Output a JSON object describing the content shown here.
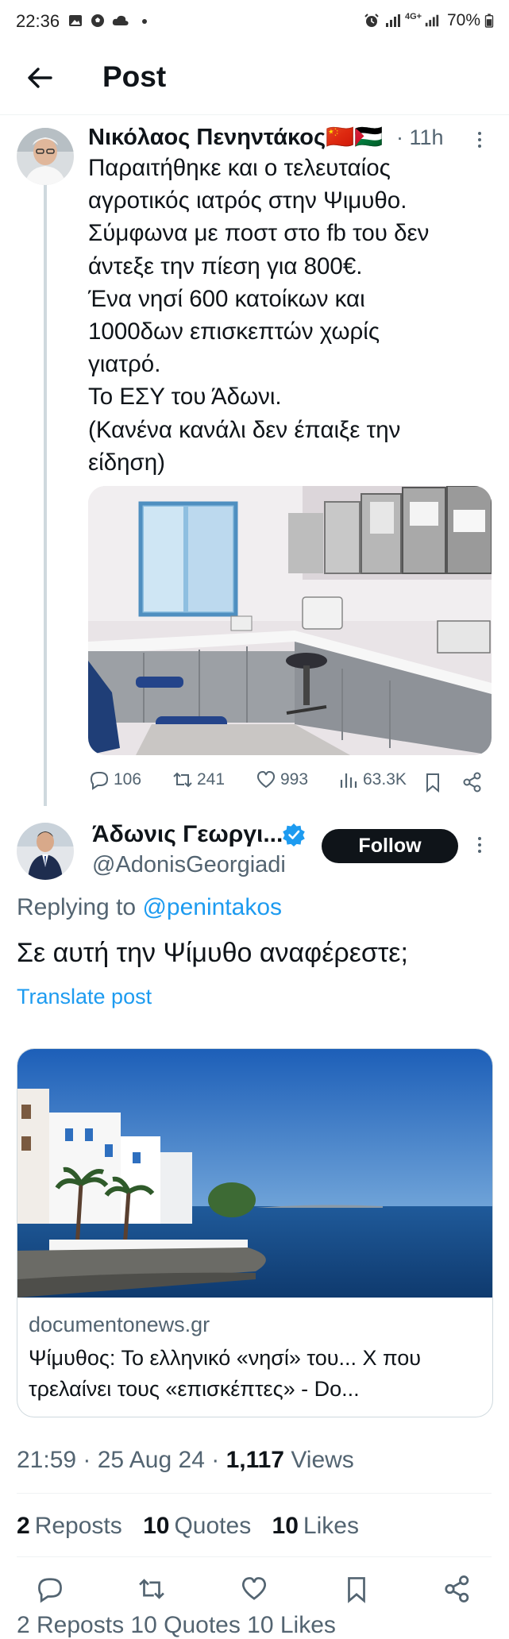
{
  "status_bar": {
    "time": "22:36",
    "battery": "70%",
    "network": "4G+"
  },
  "header": {
    "title": "Post"
  },
  "tweet1": {
    "name": "Νικόλαος Πενηντάκος",
    "name_flags": "🇨🇳🇵🇸",
    "time": "· 11h",
    "text": "Παραιτήθηκε και ο τελευταίος\nαγροτικός ιατρός στην Ψιμυθο.\nΣύμφωνα με ποστ στο fb του δεν\nάντεξε την πίεση για 800€.\nΈνα νησί 600 κατοίκων και\n1000δων επισκεπτών χωρίς\nγιατρό.\nΤο ΕΣΥ του Άδωνι.\n(Κανένα κανάλι δεν έπαιξε την\nείδηση)",
    "actions": {
      "replies": "106",
      "reposts": "241",
      "likes": "993",
      "views": "63.3K"
    }
  },
  "tweet2": {
    "name": "Άδωνις Γεωργι...",
    "handle": "@AdonisGeorgiadi",
    "follow_label": "Follow",
    "replying_prefix": "Replying to ",
    "replying_mention": "@penintakos",
    "text": "Σε αυτή την Ψίμυθο αναφέρεστε;",
    "translate_label": "Translate post",
    "card": {
      "domain": "documentonews.gr",
      "title": "Ψίμυθος: Το ελληνικό «νησί» του... Χ που τρελαίνει τους «επισκέπτες» - Do..."
    },
    "time": "21:59",
    "date": "25 Aug 24",
    "views_count": "1,117",
    "views_label": "Views",
    "stats": {
      "reposts_count": "2",
      "reposts_label": "Reposts",
      "quotes_count": "10",
      "quotes_label": "Quotes",
      "likes_count": "10",
      "likes_label": "Likes"
    },
    "ghost_text": "2 Reposts  10 Quotes  10 Likes"
  },
  "colors": {
    "accent": "#1d9bf0",
    "text": "#0f1419",
    "secondary": "#536471",
    "border": "#cfd9de"
  },
  "icons": [
    "back-arrow-icon",
    "reply-icon",
    "repost-icon",
    "like-icon",
    "views-icon",
    "bookmark-icon",
    "share-icon",
    "verified-badge-icon",
    "more-icon"
  ]
}
